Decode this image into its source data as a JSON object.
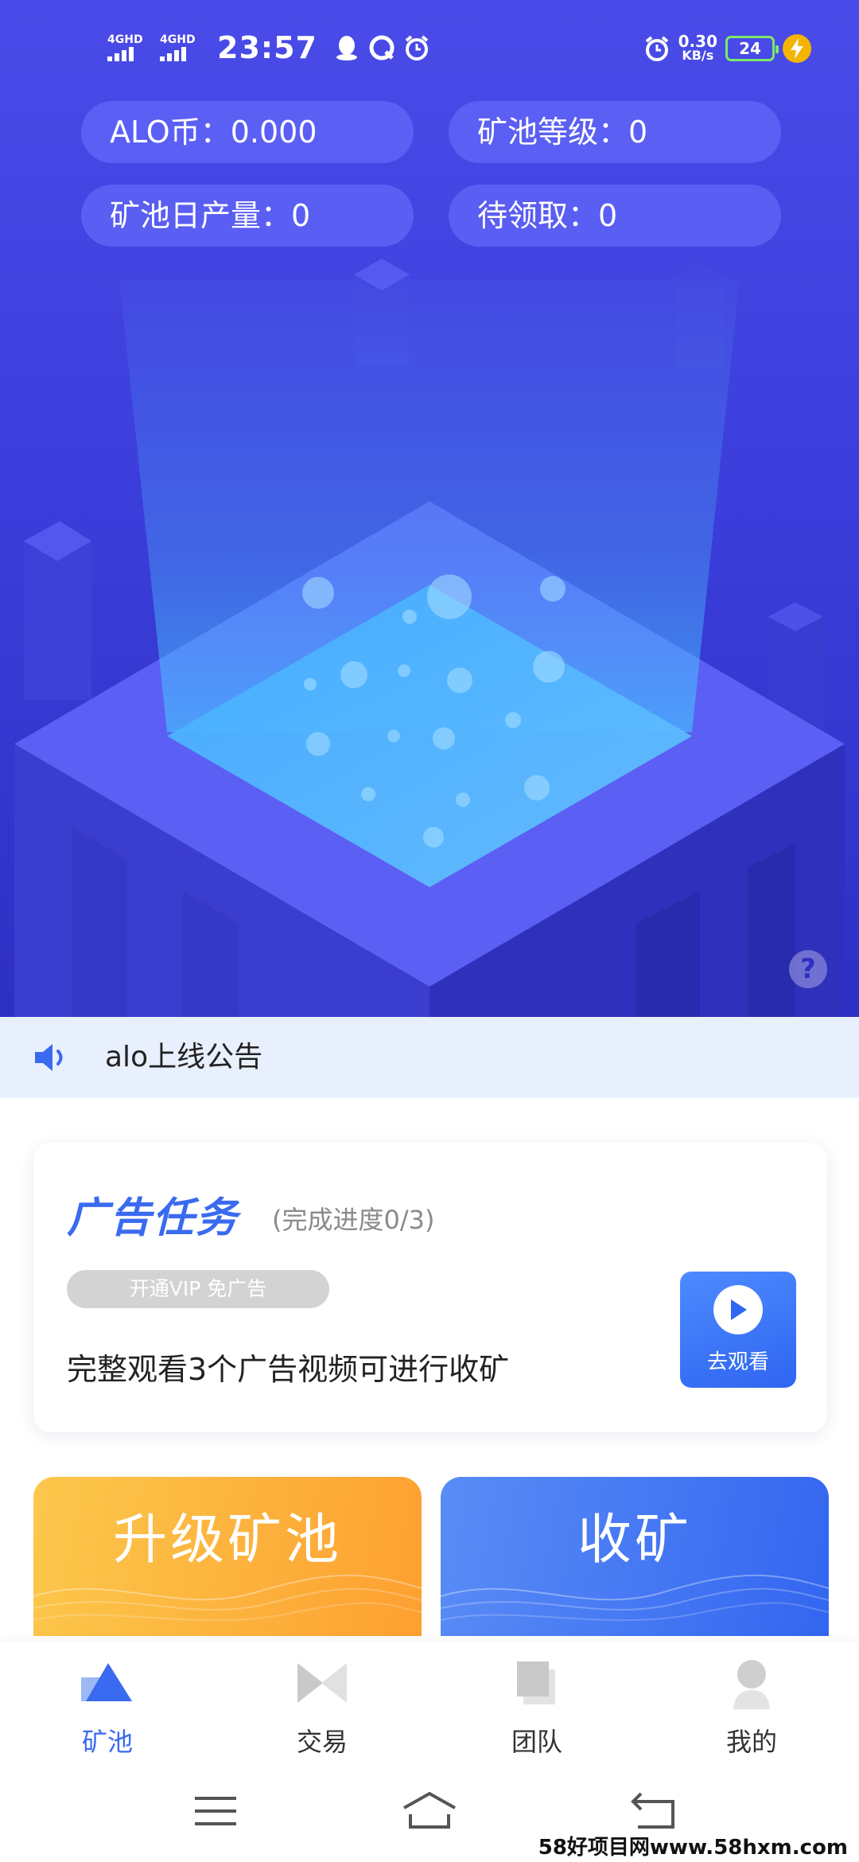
{
  "status_bar": {
    "signal1_label": "4GHD",
    "signal2_label": "4GHD",
    "time": "23:57",
    "net_speed_value": "0.30",
    "net_speed_unit": "KB/s",
    "battery_level": "24",
    "icons": [
      "qq-icon",
      "browser-icon",
      "alarm-icon",
      "alarm-icon",
      "charging-icon"
    ]
  },
  "stats": {
    "alo_coin": "ALO币：0.000",
    "pool_level": "矿池等级：0",
    "daily_output": "矿池日产量：0",
    "pending": "待领取：0"
  },
  "announcement": {
    "icon": "speaker-icon",
    "text": "alo上线公告"
  },
  "ad_task": {
    "title": "广告任务",
    "progress": "(完成进度0/3)",
    "vip_label": "开通VIP 免广告",
    "description": "完整观看3个广告视频可进行收矿",
    "watch_label": "去观看"
  },
  "actions": {
    "upgrade_label": "升级矿池",
    "collect_label": "收矿"
  },
  "tabs": [
    {
      "label": "矿池",
      "icon": "mining-pool-icon",
      "active": true
    },
    {
      "label": "交易",
      "icon": "trade-icon",
      "active": false
    },
    {
      "label": "团队",
      "icon": "team-icon",
      "active": false
    },
    {
      "label": "我的",
      "icon": "profile-icon",
      "active": false
    }
  ],
  "colors": {
    "hero_top": "#4a4be8",
    "hero_bottom": "#2e2fc4",
    "accent_blue": "#3a6af0",
    "upgrade_orange": "#fda030",
    "announce_bg": "#e9f0fd"
  },
  "watermark": "58好项目网www.58hxm.com"
}
